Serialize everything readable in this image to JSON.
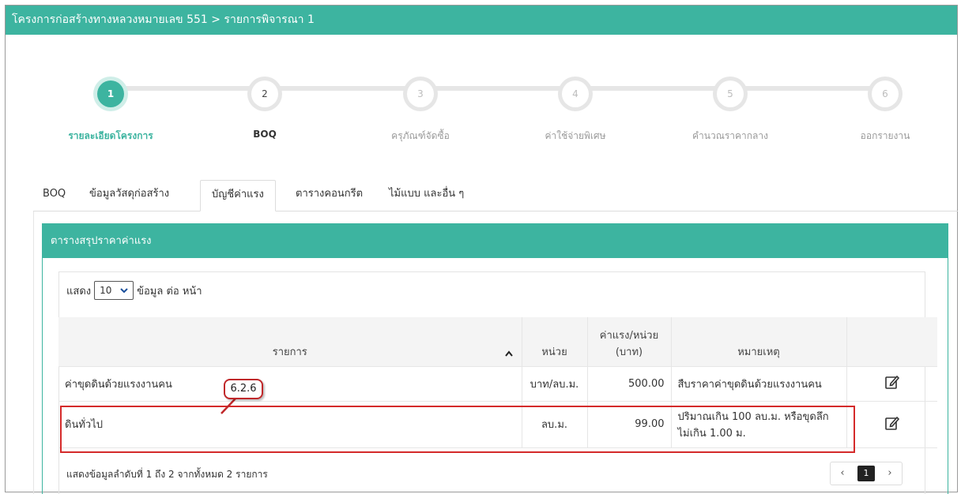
{
  "header": {
    "title": "โครงการก่อสร้างทางหลวงหมายเลข 551 > รายการพิจารณา 1"
  },
  "stepper": {
    "steps": [
      {
        "number": "1",
        "label": "รายละเอียดโครงการ",
        "state": "active"
      },
      {
        "number": "2",
        "label": "BOQ",
        "state": "done"
      },
      {
        "number": "3",
        "label": "ครุภัณฑ์จัดซื้อ",
        "state": "pending"
      },
      {
        "number": "4",
        "label": "ค่าใช้จ่ายพิเศษ",
        "state": "pending"
      },
      {
        "number": "5",
        "label": "คำนวณราคากลาง",
        "state": "pending"
      },
      {
        "number": "6",
        "label": "ออกรายงาน",
        "state": "pending"
      }
    ]
  },
  "tabs": [
    {
      "label": "BOQ"
    },
    {
      "label": "ข้อมูลวัสดุก่อสร้าง"
    },
    {
      "label": "บัญชีค่าแรง",
      "active": true
    },
    {
      "label": "ตารางคอนกรีต"
    },
    {
      "label": "ไม้แบบ และอื่น ๆ"
    }
  ],
  "panel": {
    "title": "ตารางสรุปราคาค่าแรง"
  },
  "length_control": {
    "prefix": "แสดง",
    "selected": "10",
    "suffix": "ข้อมูล ต่อ หน้า"
  },
  "table": {
    "headers": {
      "item": "รายการ",
      "unit": "หน่วย",
      "price_line1": "ค่าแรง/หน่วย",
      "price_line2": "(บาท)",
      "note": "หมายเหตุ"
    },
    "rows": [
      {
        "item": "ค่าขุดดินด้วยแรงงานคน",
        "unit": "บาท/ลบ.ม.",
        "price": "500.00",
        "note": "สืบราคาค่าขุดดินด้วยแรงงานคน"
      },
      {
        "item": "ดินทั่วไป",
        "unit": "ลบ.ม.",
        "price": "99.00",
        "note": "ปริมาณเกิน 100 ลบ.ม. หรือขุดลึกไม่เกิน 1.00 ม."
      }
    ]
  },
  "callout": {
    "label": "6.2.6"
  },
  "footer": {
    "info": "แสดงข้อมูลลำดับที่ 1 ถึง 2 จากทั้งหมด 2 รายการ",
    "pager": {
      "prev": "‹",
      "current": "1",
      "next": "›"
    }
  },
  "colors": {
    "accent": "#3db4a0",
    "highlight": "#d42a2a"
  }
}
